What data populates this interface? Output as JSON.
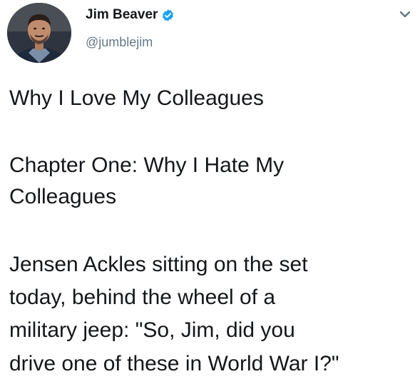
{
  "author": {
    "display_name": "Jim Beaver",
    "handle": "@jumblejim",
    "verified": true,
    "avatar_icon": "profile-photo"
  },
  "menu": {
    "icon": "chevron-down-icon"
  },
  "tweet": {
    "lines": [
      "Why I Love My Colleagues",
      "Chapter One:  Why I Hate My",
      "Colleagues",
      "Jensen Ackles sitting on the set",
      "today, behind the wheel of a",
      "military jeep:  \"So, Jim, did you",
      "drive one of these in World War I?\""
    ]
  },
  "colors": {
    "text": "#14171a",
    "secondary": "#657786",
    "verified_badge": "#1da1f2",
    "background": "#ffffff"
  }
}
